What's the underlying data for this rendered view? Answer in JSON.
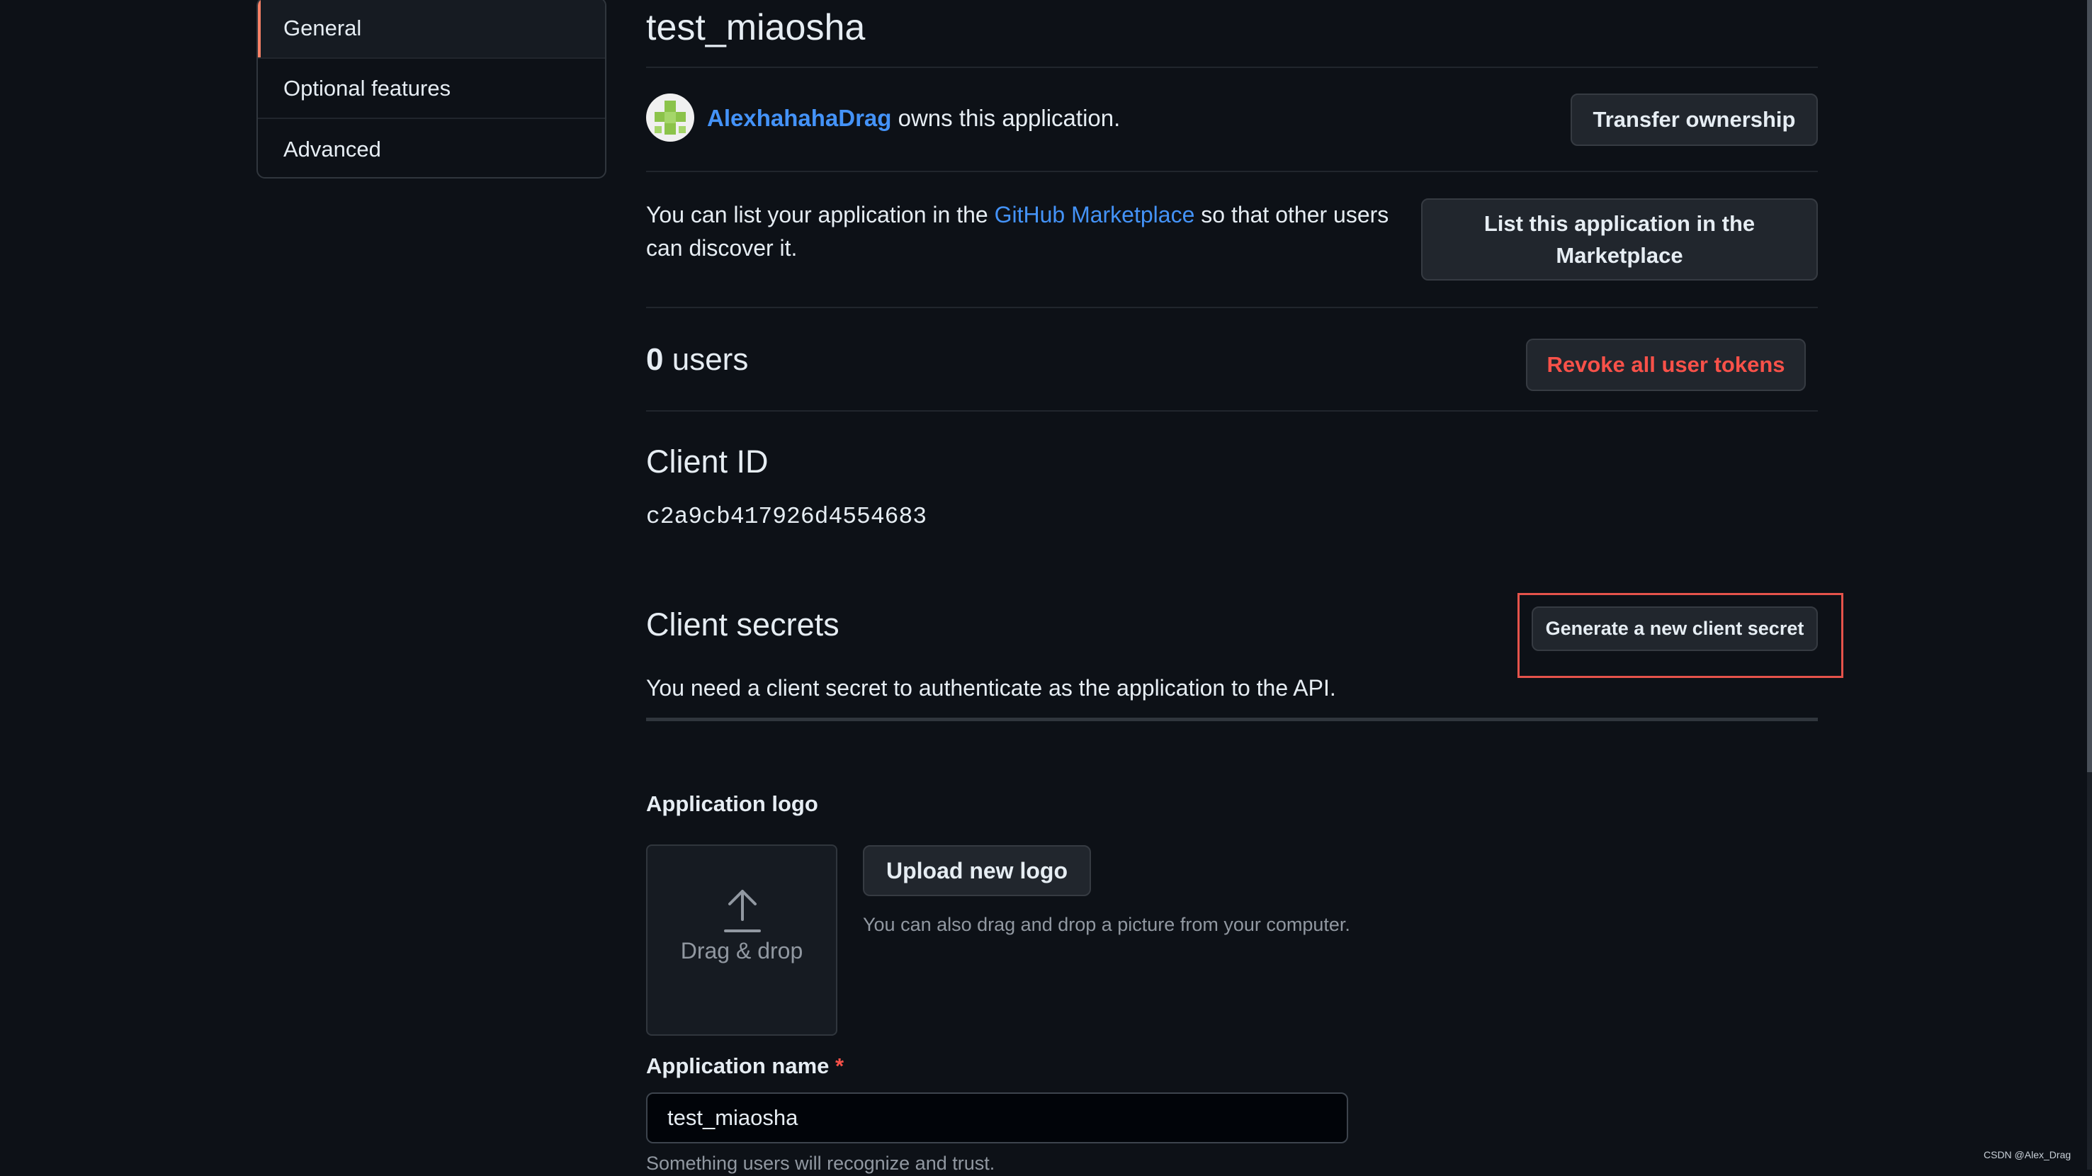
{
  "sidebar": {
    "items": [
      {
        "label": "General",
        "active": true
      },
      {
        "label": "Optional features",
        "active": false
      },
      {
        "label": "Advanced",
        "active": false
      }
    ]
  },
  "app": {
    "title": "test_miaosha",
    "owner_name": "AlexhahahaDrag",
    "owner_suffix": "owns this application."
  },
  "buttons": {
    "transfer": "Transfer ownership",
    "list_marketplace": "List this application in the Marketplace",
    "revoke": "Revoke all user tokens",
    "generate_secret": "Generate a new client secret",
    "upload_logo": "Upload new logo"
  },
  "marketplace": {
    "prefix": "You can list your application in the",
    "link": "GitHub Marketplace",
    "suffix": "so that other users can discover it."
  },
  "users": {
    "count": "0",
    "label": "users"
  },
  "client_id": {
    "heading": "Client ID",
    "value": "c2a9cb417926d4554683"
  },
  "client_secrets": {
    "heading": "Client secrets",
    "description": "You need a client secret to authenticate as the application to the API."
  },
  "logo": {
    "heading": "Application logo",
    "dropzone_label": "Drag & drop",
    "hint": "You can also drag and drop a picture from your computer."
  },
  "app_name": {
    "label": "Application name",
    "required_mark": "*",
    "value": "test_miaosha",
    "hint": "Something users will recognize and trust."
  },
  "watermark": "CSDN @Alex_Drag",
  "colors": {
    "background": "#0d1117",
    "link": "#4493f8",
    "danger": "#f85149",
    "highlight_box": "#e5534b",
    "active_indicator": "#f78166"
  },
  "icons": {
    "upload": "upload-arrow-icon",
    "avatar": "identicon-avatar"
  }
}
